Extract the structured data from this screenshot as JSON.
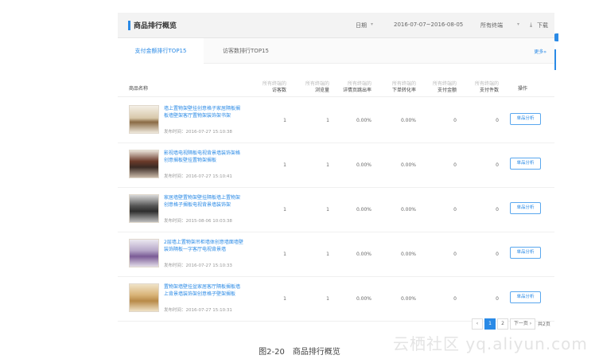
{
  "header": {
    "title": "商品排行概览",
    "date_label": "日期",
    "date_range": "2016-07-07~2016-08-05",
    "terminal_label": "所有终端",
    "download_label": "下载"
  },
  "tabs": [
    {
      "label": "支付金额排行TOP15",
      "active": true
    },
    {
      "label": "访客数排行TOP15",
      "active": false
    }
  ],
  "more_label": "更多»",
  "columns": {
    "name": "商品名称",
    "sub": "所有终端的",
    "visitors": "访客数",
    "views": "浏览量",
    "bounce": "详情页跳出率",
    "conversion": "下单转化率",
    "amount": "支付金额",
    "pieces": "支付件数",
    "action": "操作"
  },
  "rows": [
    {
      "name": "墙上置物架壁挂创意格子家居隔板搁板墙壁架客厅置物架装饰架书架",
      "time": "发布时间：2016-07-27 15:10:38",
      "visitors": "1",
      "views": "1",
      "bounce": "0.00%",
      "conversion": "0.00%",
      "amount": "0",
      "pieces": "0",
      "action": "单品分析"
    },
    {
      "name": "影视墙电视隔板电视背景墙装饰架格创意搁板壁挂置物架搁板",
      "time": "发布时间：2016-07-27 15:10:41",
      "visitors": "1",
      "views": "1",
      "bounce": "0.00%",
      "conversion": "0.00%",
      "amount": "0",
      "pieces": "0",
      "action": "单品分析"
    },
    {
      "name": "家居墙壁置物架壁挂隔板墙上置物架创意格子搁板电视背景墙装饰架",
      "time": "发布时间：2015-08-06 10:03:38",
      "visitors": "1",
      "views": "1",
      "bounce": "0.00%",
      "conversion": "0.00%",
      "amount": "0",
      "pieces": "0",
      "action": "单品分析"
    },
    {
      "name": "2层墙上置物架吊柜墙体创意墙面墙壁装饰隔板一字客厅电视背景墙",
      "time": "发布时间：2016-07-27 15:10:33",
      "visitors": "1",
      "views": "1",
      "bounce": "0.00%",
      "conversion": "0.00%",
      "amount": "0",
      "pieces": "0",
      "action": "单品分析"
    },
    {
      "name": "置物架墙壁挂盆家居客厅隔板搁板墙上背景墙装饰架创意格子壁架搁板",
      "time": "发布时间：2016-07-27 15:10:31",
      "visitors": "1",
      "views": "1",
      "bounce": "0.00%",
      "conversion": "0.00%",
      "amount": "0",
      "pieces": "0",
      "action": "单品分析"
    }
  ],
  "pagination": {
    "prev": "‹",
    "pages": [
      "1",
      "2"
    ],
    "current": "1",
    "next": "下一页 ›",
    "total": "共2页"
  },
  "caption": "图2-20　商品排行概览",
  "watermark": "云栖社区 yq.aliyun.com",
  "colors": {
    "accent": "#2a8ae6",
    "header_bg": "#f3f3f3"
  }
}
